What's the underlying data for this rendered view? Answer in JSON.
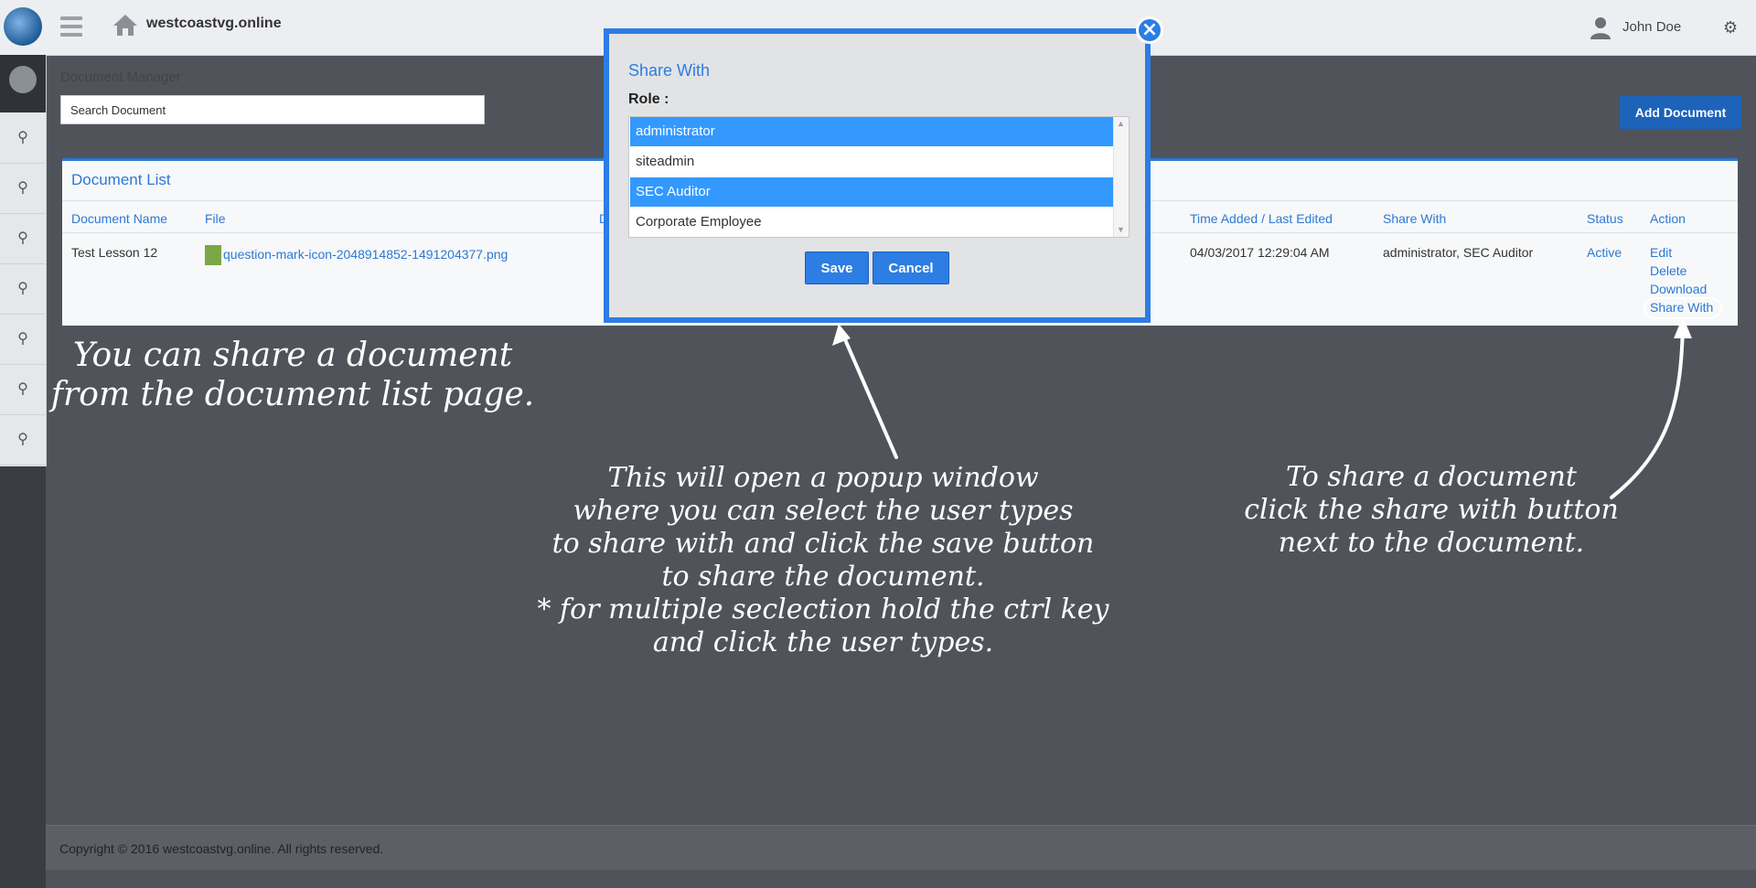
{
  "header": {
    "site_name": "westcoastvg.online",
    "user_name": "John Doe"
  },
  "page": {
    "title": "Document Manager",
    "search_placeholder": "Search Document",
    "add_button": "Add Document"
  },
  "document_list": {
    "title": "Document List",
    "columns": [
      "Document Name",
      "File",
      "D",
      "Time Added / Last Edited",
      "Share With",
      "Status",
      "Action"
    ],
    "rows": [
      {
        "name": "Test Lesson 12",
        "file": "question-mark-icon-2048914852-1491204377.png",
        "time": "04/03/2017 12:29:04 AM",
        "share_with": "administrator, SEC Auditor",
        "status": "Active",
        "actions": [
          "Edit",
          "Delete",
          "Download",
          "Share With"
        ]
      }
    ]
  },
  "modal": {
    "title": "Share With",
    "role_label": "Role :",
    "roles": [
      {
        "label": "administrator",
        "selected": true
      },
      {
        "label": "siteadmin",
        "selected": false
      },
      {
        "label": "SEC Auditor",
        "selected": true
      },
      {
        "label": "Corporate Employee",
        "selected": false
      }
    ],
    "save": "Save",
    "cancel": "Cancel",
    "close": "×"
  },
  "annotations": {
    "left": "You can share a document\nfrom the document list page.",
    "middle": "This will open a popup window\nwhere you can select the user types\nto share with and click the save button\nto share the document.\n* for multiple seclection hold the ctrl key\nand click the user types.",
    "right": "To share a document\nclick the share with button\nnext to the document."
  },
  "footer": {
    "copyright": "Copyright © 2016 westcoastvg.online. All rights reserved."
  },
  "colors": {
    "accent": "#2c7de4",
    "selected": "#3399ff",
    "overlay": "#50535a"
  }
}
